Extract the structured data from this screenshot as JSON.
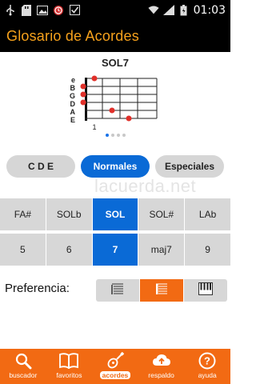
{
  "status_bar": {
    "time": "01:03",
    "left_icons": [
      "usb-icon",
      "sd-card-icon",
      "image-icon",
      "alarm-icon",
      "checkbox-icon"
    ],
    "right_icons": [
      "wifi-icon",
      "signal-icon",
      "battery-icon"
    ]
  },
  "app_bar": {
    "title": "Glosario de Acordes"
  },
  "chord": {
    "name": "SOL7",
    "strings": [
      "e",
      "B",
      "G",
      "D",
      "A",
      "E"
    ],
    "fret_label": "1",
    "pages": 4,
    "current_page": 1
  },
  "categories": {
    "items": [
      "C D E",
      "Normales",
      "Especiales"
    ],
    "selected": "Normales"
  },
  "watermark": "lacuerda.net",
  "tones": {
    "items": [
      "FA#",
      "SOLb",
      "SOL",
      "SOL#",
      "LAb"
    ],
    "selected": "SOL"
  },
  "types": {
    "items": [
      "5",
      "6",
      "7",
      "maj7",
      "9"
    ],
    "selected": "7"
  },
  "preference": {
    "label": "Preferencia:",
    "options": [
      "staff-notation-icon",
      "tablature-icon",
      "piano-keys-icon"
    ],
    "selected": "tablature-icon"
  },
  "bottom_nav": {
    "items": [
      {
        "label": "buscador",
        "icon": "search-icon"
      },
      {
        "label": "favoritos",
        "icon": "book-icon"
      },
      {
        "label": "acordes",
        "icon": "guitar-icon"
      },
      {
        "label": "respaldo",
        "icon": "cloud-upload-icon"
      },
      {
        "label": "ayuda",
        "icon": "help-icon"
      }
    ],
    "selected": "acordes"
  },
  "colors": {
    "accent_orange": "#f26a13",
    "title_orange": "#f7a21c",
    "selected_blue": "#0a6ad6",
    "inactive_gray": "#d7d7d7",
    "chord_dot_red": "#e0302a"
  }
}
